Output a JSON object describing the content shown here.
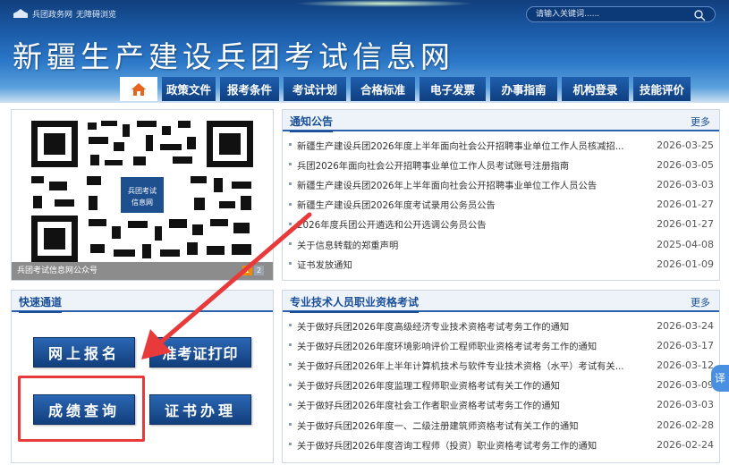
{
  "topbar": {
    "gov_link": "兵团政务网",
    "accessibility_link": "无障碍浏览",
    "search_placeholder": "请输入关键词......"
  },
  "site_title": "新疆生产建设兵团考试信息网",
  "nav": [
    "政策文件",
    "报考条件",
    "考试计划",
    "合格标准",
    "电子发票",
    "办事指南",
    "机构登录",
    "技能评价"
  ],
  "banner": {
    "caption": "兵团考试信息网公众号",
    "pages": [
      "1",
      "2"
    ]
  },
  "quick": {
    "title": "快速通道",
    "buttons": [
      "网上报名",
      "准考证打印",
      "成绩查询",
      "证书办理"
    ]
  },
  "notice": {
    "title": "通知公告",
    "more": "更多",
    "items": [
      {
        "title": "新疆生产建设兵团2026年度上半年面向社会公开招聘事业单位工作人员核减招...",
        "date": "2026-03-25"
      },
      {
        "title": "兵团2026年面向社会公开招聘事业单位工作人员考试账号注册指南",
        "date": "2026-03-05"
      },
      {
        "title": "新疆生产建设兵团2026年上半年面向社会公开招聘事业单位工作人员公告",
        "date": "2026-03-03"
      },
      {
        "title": "新疆生产建设兵团2026年度考试录用公务员公告",
        "date": "2026-01-27"
      },
      {
        "title": "2026年度兵团公开遴选和公开选调公务员公告",
        "date": "2026-01-27"
      },
      {
        "title": "关于信息转载的郑重声明",
        "date": "2025-04-08"
      },
      {
        "title": "证书发放通知",
        "date": "2026-01-09"
      }
    ]
  },
  "professional": {
    "title": "专业技术人员职业资格考试",
    "more": "更多",
    "items": [
      {
        "title": "关于做好兵团2026年度高级经济专业技术资格考试考务工作的通知",
        "date": "2026-03-24"
      },
      {
        "title": "关于做好兵团2026年度环境影响评价工程师职业资格考试考务工作的通知",
        "date": "2026-03-17"
      },
      {
        "title": "关于做好兵团2026年上半年计算机技术与软件专业技术资格（水平）考试有关...",
        "date": "2026-03-12"
      },
      {
        "title": "关于做好兵团2026年度监理工程师职业资格考试有关工作的通知",
        "date": "2026-03-09"
      },
      {
        "title": "关于做好兵团2026年度社会工作者职业资格考试考务工作的通知",
        "date": "2026-03-03"
      },
      {
        "title": "关于做好兵团2026年度一、二级注册建筑师资格考试有关工作的通知",
        "date": "2026-02-28"
      },
      {
        "title": "关于做好兵团2026年度咨询工程师（投资）职业资格考试考务工作的通知",
        "date": "2026-02-24"
      }
    ]
  },
  "translate": "译",
  "colors": {
    "brand_dark": "#123f7d",
    "accent": "#1a4f98",
    "highlight": "#e83a3a"
  }
}
